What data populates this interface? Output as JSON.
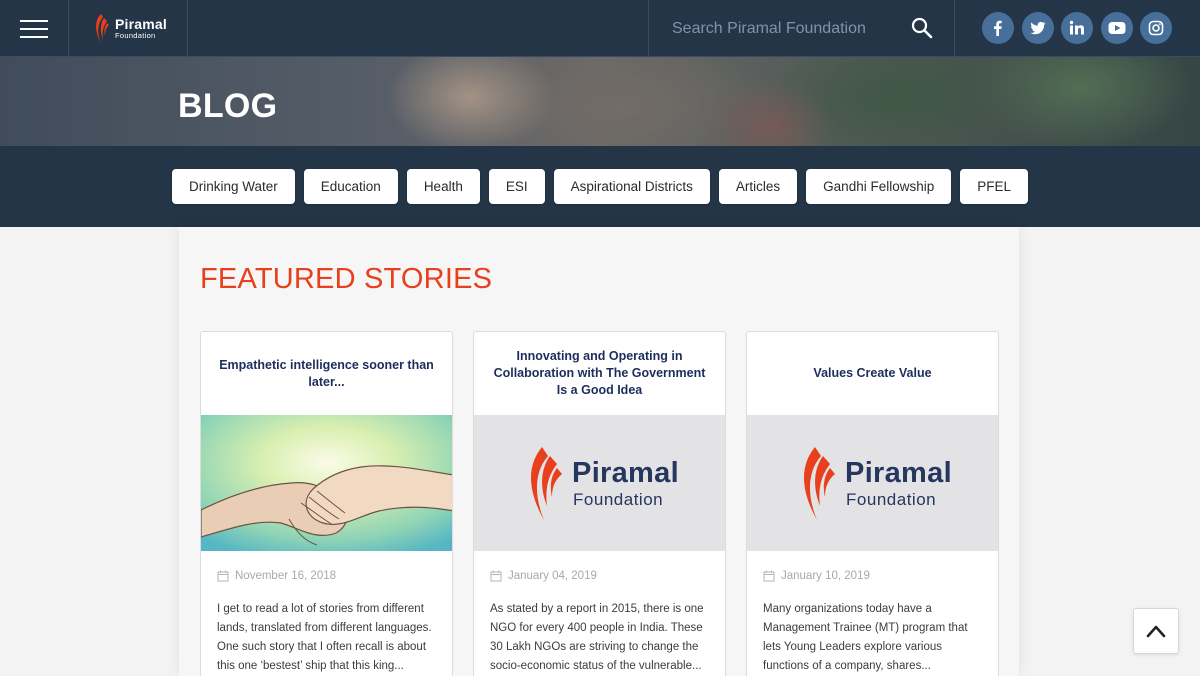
{
  "brand": {
    "name": "Piramal",
    "sub": "Foundation"
  },
  "search": {
    "placeholder": "Search Piramal Foundation"
  },
  "socials": [
    {
      "icon": "facebook-icon",
      "glyph": "f"
    },
    {
      "icon": "twitter-icon",
      "glyph": "t"
    },
    {
      "icon": "linkedin-icon",
      "glyph": "in"
    },
    {
      "icon": "youtube-icon",
      "glyph": "yt"
    },
    {
      "icon": "instagram-icon",
      "glyph": "ig"
    }
  ],
  "hero": {
    "title": "BLOG"
  },
  "categories": [
    "Drinking Water",
    "Education",
    "Health",
    "ESI",
    "Aspirational Districts",
    "Articles",
    "Gandhi Fellowship",
    "PFEL"
  ],
  "featured": {
    "title": "FEATURED STORIES",
    "cards": [
      {
        "title": "Empathetic intelligence sooner than later...",
        "date": "November 16, 2018",
        "excerpt": "I get to read a lot of stories from different lands, translated from different languages. One such story that I often recall is about this one ‘bestest’ ship that this king..."
      },
      {
        "title": "Innovating and Operating in Collaboration with The Government Is a Good Idea",
        "date": "January 04, 2019",
        "excerpt": "As stated by a report in 2015, there is one NGO for every 400 people in India. These 30 Lakh NGOs are striving to change the socio-economic status of the vulnerable..."
      },
      {
        "title": "Values Create Value",
        "date": "January 10, 2019",
        "excerpt": "Many organizations today have a Management Trainee (MT) program that lets Young Leaders explore various functions of a company, shares..."
      }
    ]
  },
  "colors": {
    "navy": "#243547",
    "accent": "#e8401c",
    "social": "#476f9a"
  }
}
